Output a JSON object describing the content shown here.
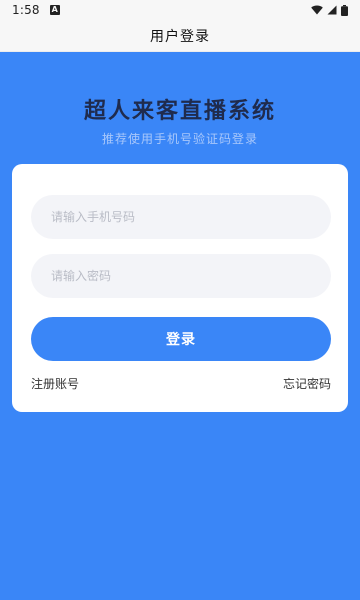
{
  "status_bar": {
    "time": "1:58",
    "notification_badge": "A",
    "icons": [
      "wifi-icon",
      "signal-icon",
      "battery-icon"
    ]
  },
  "header": {
    "title": "用户登录"
  },
  "hero": {
    "title": "超人来客直播系统",
    "subtitle": "推荐使用手机号验证码登录"
  },
  "form": {
    "phone": {
      "value": "",
      "placeholder": "请输入手机号码"
    },
    "password": {
      "value": "",
      "placeholder": "请输入密码"
    },
    "login_label": "登录",
    "register_label": "注册账号",
    "forgot_label": "忘记密码"
  },
  "colors": {
    "background": "#3a86f7",
    "button": "#3a86f7",
    "card": "#ffffff",
    "title": "#1f2b4d",
    "subtitle": "#a9c8fb",
    "field_bg": "#f3f4f8"
  }
}
